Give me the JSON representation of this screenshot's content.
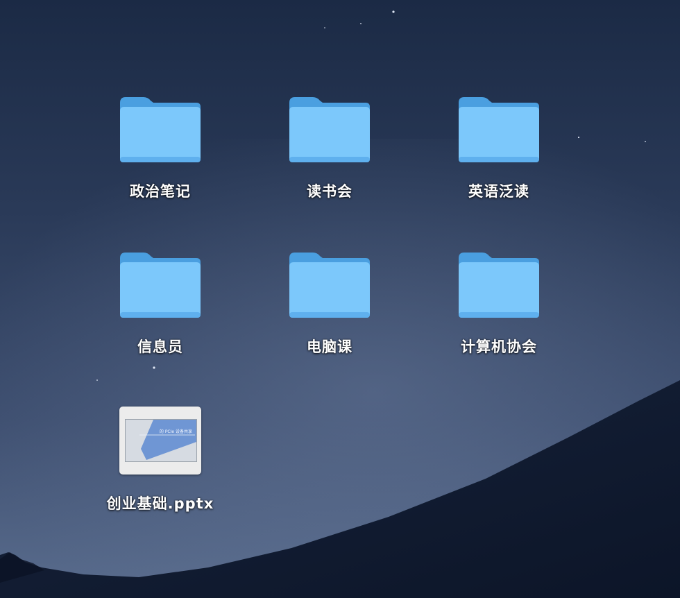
{
  "desktop": {
    "items": [
      {
        "type": "folder",
        "label": "政治笔记",
        "icon": "folder-icon"
      },
      {
        "type": "folder",
        "label": "读书会",
        "icon": "folder-icon"
      },
      {
        "type": "folder",
        "label": "英语泛读",
        "icon": "folder-icon"
      },
      {
        "type": "folder",
        "label": "信息员",
        "icon": "folder-icon"
      },
      {
        "type": "folder",
        "label": "电脑课",
        "icon": "folder-icon"
      },
      {
        "type": "folder",
        "label": "计算机协会",
        "icon": "folder-icon"
      },
      {
        "type": "file",
        "label": "创业基础.pptx",
        "icon": "pptx-thumbnail",
        "thumbnail_text": "的 PCIe 设备共享"
      }
    ]
  },
  "colors": {
    "folder_front": "#7cc8fb",
    "folder_back": "#4a9fe0",
    "sky_top": "#1a2a44",
    "sky_mid": "#3a4a6a",
    "dune": "#101c33"
  }
}
